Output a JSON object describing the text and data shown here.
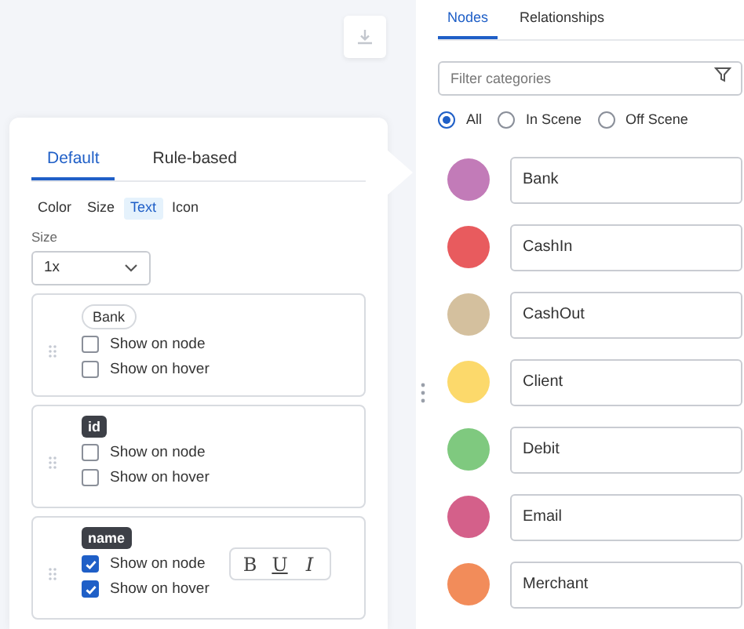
{
  "popover": {
    "tabs": [
      {
        "label": "Default",
        "selected": true
      },
      {
        "label": "Rule-based",
        "selected": false
      }
    ],
    "subtabs": [
      {
        "label": "Color",
        "selected": false
      },
      {
        "label": "Size",
        "selected": false
      },
      {
        "label": "Text",
        "selected": true
      },
      {
        "label": "Icon",
        "selected": false
      }
    ],
    "size_label": "Size",
    "size_value": "1x",
    "properties": [
      {
        "tag": "Bank",
        "kind": "category",
        "options": [
          {
            "label": "Show on node",
            "checked": false
          },
          {
            "label": "Show on hover",
            "checked": false
          }
        ]
      },
      {
        "tag": "id",
        "kind": "property",
        "options": [
          {
            "label": "Show on node",
            "checked": false
          },
          {
            "label": "Show on hover",
            "checked": false
          }
        ]
      },
      {
        "tag": "name",
        "kind": "property",
        "options": [
          {
            "label": "Show on node",
            "checked": true
          },
          {
            "label": "Show on hover",
            "checked": true
          }
        ],
        "style_buttons": [
          "B",
          "U",
          "I"
        ]
      }
    ]
  },
  "panel": {
    "tabs": [
      {
        "label": "Nodes",
        "selected": true
      },
      {
        "label": "Relationships",
        "selected": false
      }
    ],
    "filter": {
      "placeholder": "Filter categories"
    },
    "scope": [
      {
        "label": "All",
        "selected": true
      },
      {
        "label": "In Scene",
        "selected": false
      },
      {
        "label": "Off Scene",
        "selected": false
      }
    ],
    "categories": [
      {
        "name": "Bank",
        "color": "#c27bb8"
      },
      {
        "name": "CashIn",
        "color": "#e85b5e"
      },
      {
        "name": "CashOut",
        "color": "#d4c09e"
      },
      {
        "name": "Client",
        "color": "#fcd96b"
      },
      {
        "name": "Debit",
        "color": "#7fc97f"
      },
      {
        "name": "Email",
        "color": "#d4608a"
      },
      {
        "name": "Merchant",
        "color": "#f28c5a"
      }
    ]
  }
}
